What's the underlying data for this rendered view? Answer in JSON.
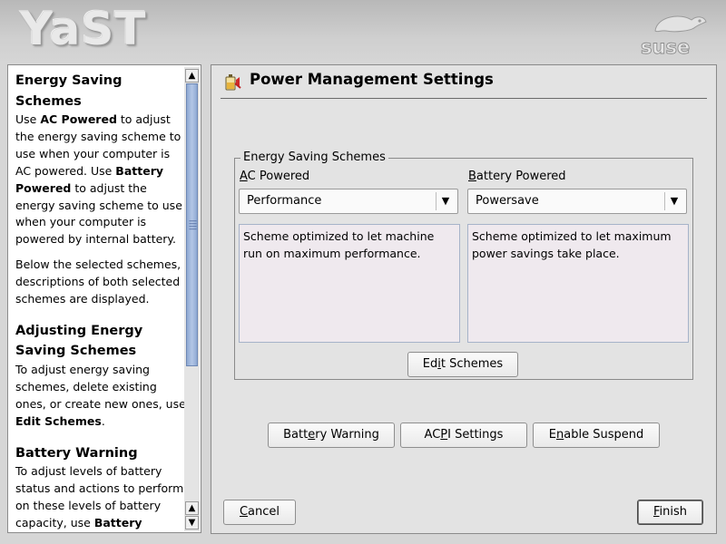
{
  "header": {
    "app_logo": "YaST",
    "vendor_logo": "suse"
  },
  "help": {
    "sections": [
      {
        "title": "Energy Saving Schemes",
        "paragraphs": [
          [
            "Use ",
            "AC Powered",
            " to adjust the energy saving scheme to use when your computer is AC powered. Use ",
            "Battery Powered",
            " to adjust the energy saving scheme to use when your computer is powered by internal battery."
          ],
          [
            "Below the selected schemes, descriptions of both selected schemes are displayed."
          ]
        ]
      },
      {
        "title": "Adjusting Energy Saving Schemes",
        "paragraphs": [
          [
            "To adjust energy saving schemes, delete existing ones, or create new ones, use ",
            "Edit Schemes",
            "."
          ]
        ]
      },
      {
        "title": "Battery Warning",
        "paragraphs": [
          [
            "To adjust levels of battery status and actions to perform on these levels of battery capacity, use ",
            "Battery"
          ]
        ]
      }
    ]
  },
  "main": {
    "title": "Power Management Settings",
    "group_label": "Energy Saving Schemes",
    "ac": {
      "label_mnemonic": "A",
      "label_rest": "C Powered",
      "selected": "Performance",
      "description": "Scheme optimized to let machine run on maximum performance."
    },
    "battery": {
      "label_mnemonic": "B",
      "label_rest": "attery Powered",
      "selected": "Powersave",
      "description": "Scheme optimized to let maximum power savings take place."
    },
    "edit_schemes": {
      "pre": "Ed",
      "key": "i",
      "post": "t Schemes"
    },
    "battery_warning": {
      "pre": "Batt",
      "key": "e",
      "post": "ry Warning"
    },
    "acpi_settings": {
      "pre": "AC",
      "key": "P",
      "post": "I Settings"
    },
    "enable_suspend": {
      "pre": "E",
      "key": "n",
      "post": "able Suspend"
    }
  },
  "footer": {
    "cancel": {
      "pre": "",
      "key": "C",
      "post": "ancel"
    },
    "finish": {
      "pre": "",
      "key": "F",
      "post": "inish"
    }
  },
  "colors": {
    "scroll_thumb": "#8fa9d3",
    "description_bg": "#efe9ee",
    "panel_bg": "#e3e3e3"
  }
}
